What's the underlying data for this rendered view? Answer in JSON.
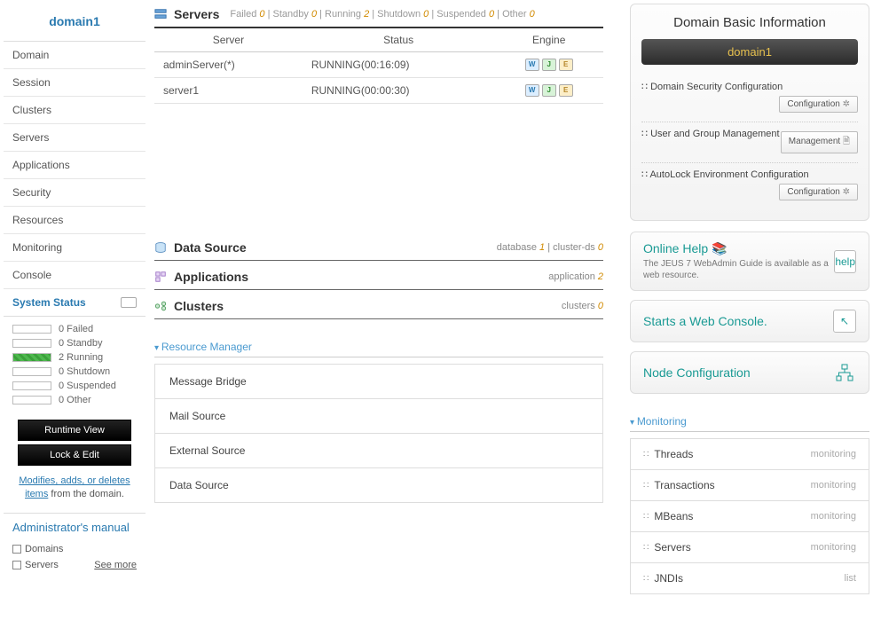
{
  "sidebar": {
    "title": "domain1",
    "nav": [
      "Domain",
      "Session",
      "Clusters",
      "Servers",
      "Applications",
      "Security",
      "Resources",
      "Monitoring",
      "Console"
    ],
    "systemStatusLabel": "System Status",
    "status": [
      {
        "count": 0,
        "label": "Failed",
        "cls": ""
      },
      {
        "count": 0,
        "label": "Standby",
        "cls": ""
      },
      {
        "count": 2,
        "label": "Running",
        "cls": "running"
      },
      {
        "count": 0,
        "label": "Shutdown",
        "cls": ""
      },
      {
        "count": 0,
        "label": "Suspended",
        "cls": ""
      },
      {
        "count": 0,
        "label": "Other",
        "cls": ""
      }
    ],
    "buttons": {
      "runtime": "Runtime View",
      "lock": "Lock & Edit"
    },
    "note": {
      "link": "Modifies, adds, or deletes items",
      "rest": " from the domain."
    },
    "manual": {
      "title": "Administrator's manual",
      "items": [
        "Domains",
        "Servers"
      ],
      "seeMore": "See more"
    }
  },
  "servers": {
    "title": "Servers",
    "countsText": [
      "Failed ",
      "0",
      " | Standby ",
      "0",
      " | Running ",
      "2",
      " | Shutdown ",
      "0",
      " | Suspended ",
      "0",
      " | Other ",
      "0"
    ],
    "cols": [
      "Server",
      "Status",
      "Engine"
    ],
    "rows": [
      {
        "server": "adminServer(*)",
        "status": "RUNNING(00:16:09)"
      },
      {
        "server": "server1",
        "status": "RUNNING(00:00:30)"
      }
    ]
  },
  "dataSource": {
    "title": "Data Source",
    "right": [
      "database ",
      "1",
      " | cluster-ds ",
      "0"
    ]
  },
  "applications": {
    "title": "Applications",
    "right": [
      "application ",
      "2"
    ]
  },
  "clusters": {
    "title": "Clusters",
    "right": [
      "clusters ",
      "0"
    ]
  },
  "resourceMgr": {
    "title": "Resource Manager",
    "items": [
      "Message Bridge",
      "Mail Source",
      "External Source",
      "Data Source"
    ]
  },
  "basicInfo": {
    "title": "Domain Basic Information",
    "domainName": "domain1",
    "rows": [
      {
        "label": "Domain Security Configuration",
        "btn": "Configuration",
        "btncls": "gear"
      },
      {
        "label": "User and Group Management",
        "btn": "Management",
        "btncls": "doc"
      },
      {
        "label": "AutoLock Environment Configuration",
        "btn": "Configuration",
        "btncls": "gear"
      }
    ]
  },
  "help": {
    "title": "Online Help",
    "desc": "The JEUS 7 WebAdmin Guide is available as a web resource.",
    "iconTxt": "help"
  },
  "webConsole": {
    "title": "Starts a Web Console."
  },
  "nodeConfig": {
    "title": "Node Configuration"
  },
  "monitoring": {
    "title": "Monitoring",
    "items": [
      {
        "label": "Threads",
        "tag": "monitoring"
      },
      {
        "label": "Transactions",
        "tag": "monitoring"
      },
      {
        "label": "MBeans",
        "tag": "monitoring"
      },
      {
        "label": "Servers",
        "tag": "monitoring"
      },
      {
        "label": "JNDIs",
        "tag": "list"
      }
    ]
  }
}
